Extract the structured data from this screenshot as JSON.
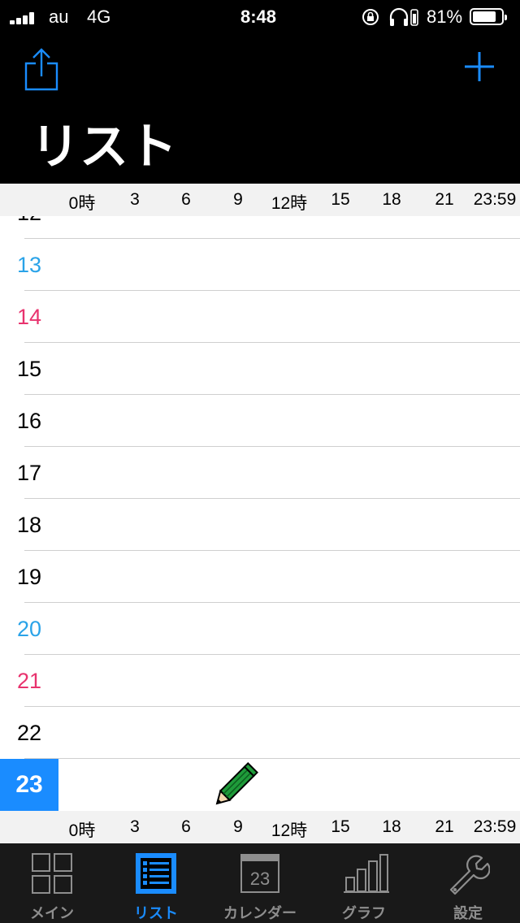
{
  "status_bar": {
    "carrier": "au",
    "network": "4G",
    "time": "8:48",
    "battery_percent": "81%",
    "battery_level": 0.81,
    "icons": [
      "signal-icon",
      "orientation-lock-icon",
      "headphones-icon",
      "battery-icon"
    ]
  },
  "nav": {
    "title": "リスト",
    "share_icon": "share-icon",
    "add_icon": "plus-icon"
  },
  "accent_color": "#1a8cff",
  "time_axis": [
    "0時",
    "3",
    "6",
    "9",
    "12時",
    "15",
    "18",
    "21",
    "23:59"
  ],
  "days": [
    {
      "label": "12",
      "color": "#000000"
    },
    {
      "label": "13",
      "color": "#2aa3e8"
    },
    {
      "label": "14",
      "color": "#e8336e"
    },
    {
      "label": "15",
      "color": "#000000"
    },
    {
      "label": "16",
      "color": "#000000"
    },
    {
      "label": "17",
      "color": "#000000"
    },
    {
      "label": "18",
      "color": "#000000"
    },
    {
      "label": "19",
      "color": "#000000"
    },
    {
      "label": "20",
      "color": "#2aa3e8"
    },
    {
      "label": "21",
      "color": "#e8336e"
    },
    {
      "label": "22",
      "color": "#000000"
    },
    {
      "label": "23",
      "color": "#ffffff",
      "today": true
    }
  ],
  "tabbar": {
    "tabs": [
      {
        "label": "メイン",
        "icon": "grid-icon",
        "active": false
      },
      {
        "label": "リスト",
        "icon": "list-icon",
        "active": true
      },
      {
        "label": "カレンダー",
        "icon": "calendar-icon",
        "active": false,
        "icon_text": "23"
      },
      {
        "label": "グラフ",
        "icon": "bar-chart-icon",
        "active": false
      },
      {
        "label": "設定",
        "icon": "wrench-icon",
        "active": false
      }
    ]
  }
}
